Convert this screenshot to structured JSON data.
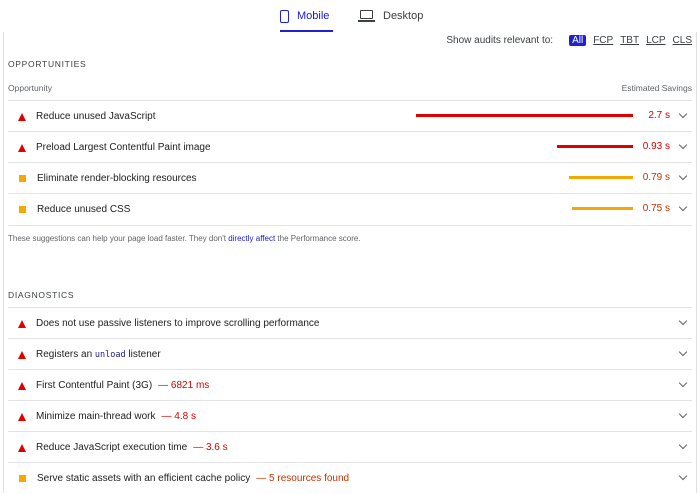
{
  "tabs": {
    "mobile": "Mobile",
    "desktop": "Desktop"
  },
  "filter": {
    "label": "Show audits relevant to:",
    "chips": [
      "All",
      "FCP",
      "TBT",
      "LCP",
      "CLS"
    ]
  },
  "opportunities": {
    "title": "OPPORTUNITIES",
    "col_left": "Opportunity",
    "col_right": "Estimated Savings",
    "items": [
      {
        "title": "Reduce unused JavaScript",
        "savings": "2.7 s",
        "severity": "fail",
        "relative_savings": 1.0
      },
      {
        "title": "Preload Largest Contentful Paint image",
        "savings": "0.93 s",
        "severity": "fail",
        "relative_savings": 0.35
      },
      {
        "title": "Eliminate render-blocking resources",
        "savings": "0.79 s",
        "severity": "average",
        "relative_savings": 0.3
      },
      {
        "title": "Reduce unused CSS",
        "savings": "0.75 s",
        "severity": "average",
        "relative_savings": 0.28
      }
    ],
    "note_before": "These suggestions can help your page load faster. They don't ",
    "note_link": "directly affect",
    "note_after": " the Performance score."
  },
  "diagnostics": {
    "title": "DIAGNOSTICS",
    "items": [
      {
        "title": "Does not use passive listeners to improve scrolling performance",
        "metric": "",
        "severity": "fail"
      },
      {
        "title_before": "Registers an ",
        "title_code": "unload",
        "title_after": " listener",
        "severity": "fail"
      },
      {
        "title": "First Contentful Paint (3G)",
        "metric": "— 6821 ms",
        "severity": "fail"
      },
      {
        "title": "Minimize main-thread work",
        "metric": "— 4.8 s",
        "severity": "fail"
      },
      {
        "title": "Reduce JavaScript execution time",
        "metric": "— 3.6 s",
        "severity": "fail"
      },
      {
        "title": "Serve static assets with an efficient cache policy",
        "metric": "— 5 resources found",
        "severity": "average"
      }
    ]
  },
  "colors": {
    "accent": "#2020d0",
    "fail": "#e00000",
    "average": "#f5a800"
  },
  "icons": [
    "phone-icon",
    "laptop-icon",
    "fail-triangle-icon",
    "average-square-icon",
    "chevron-down-icon"
  ]
}
